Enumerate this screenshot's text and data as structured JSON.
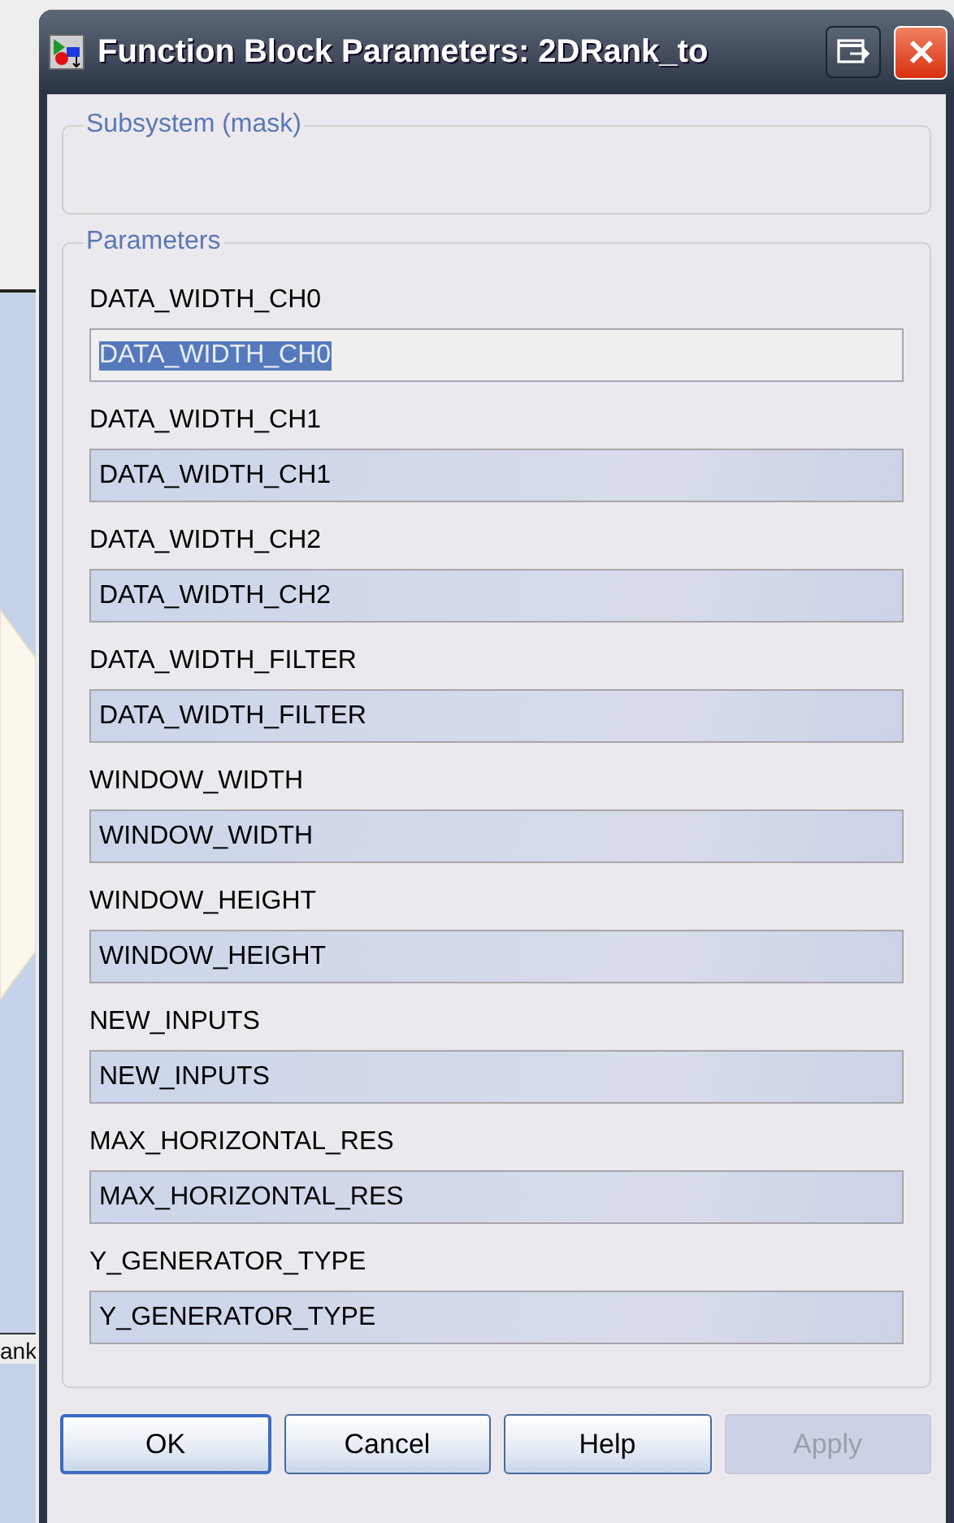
{
  "background": {
    "label": "ank"
  },
  "window": {
    "title": "Function Block Parameters: 2DRank_to"
  },
  "mask_group": {
    "title": "Subsystem (mask)"
  },
  "parameters": {
    "title": "Parameters",
    "items": [
      {
        "label": "DATA_WIDTH_CH0",
        "value": "DATA_WIDTH_CH0",
        "text_selected": true
      },
      {
        "label": "DATA_WIDTH_CH1",
        "value": "DATA_WIDTH_CH1",
        "text_selected": false
      },
      {
        "label": "DATA_WIDTH_CH2",
        "value": "DATA_WIDTH_CH2",
        "text_selected": false
      },
      {
        "label": "DATA_WIDTH_FILTER",
        "value": "DATA_WIDTH_FILTER",
        "text_selected": false
      },
      {
        "label": "WINDOW_WIDTH",
        "value": "WINDOW_WIDTH",
        "text_selected": false
      },
      {
        "label": "WINDOW_HEIGHT",
        "value": "WINDOW_HEIGHT",
        "text_selected": false
      },
      {
        "label": "NEW_INPUTS",
        "value": "NEW_INPUTS",
        "text_selected": false
      },
      {
        "label": "MAX_HORIZONTAL_RES",
        "value": "MAX_HORIZONTAL_RES",
        "text_selected": false
      },
      {
        "label": "Y_GENERATOR_TYPE",
        "value": "Y_GENERATOR_TYPE",
        "text_selected": false
      }
    ]
  },
  "buttons": [
    {
      "label": "OK",
      "default": true,
      "disabled": false
    },
    {
      "label": "Cancel",
      "default": false,
      "disabled": false
    },
    {
      "label": "Help",
      "default": false,
      "disabled": false
    },
    {
      "label": "Apply",
      "default": false,
      "disabled": true
    }
  ]
}
